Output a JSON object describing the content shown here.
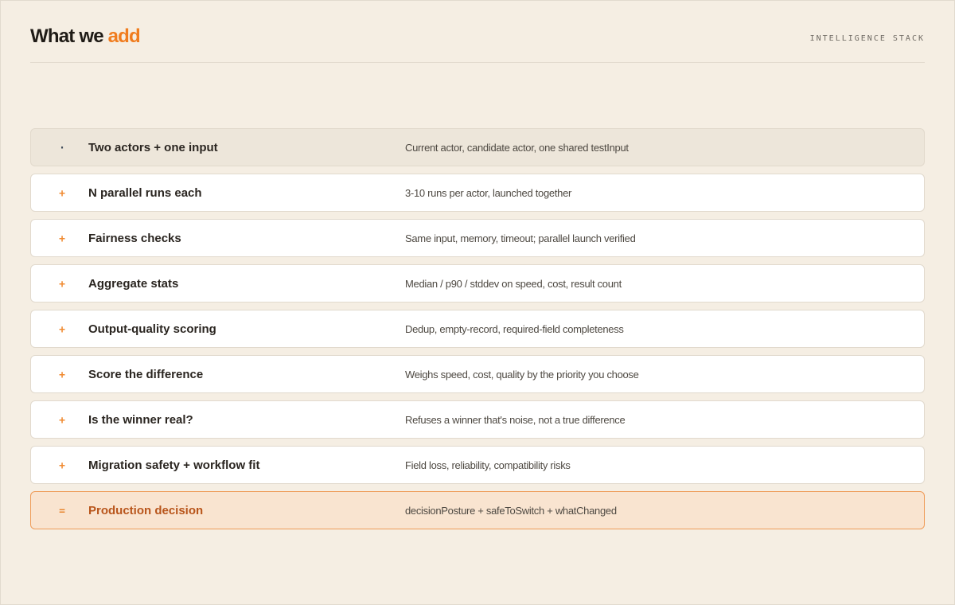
{
  "header": {
    "title_main": "What we",
    "title_accent": "add",
    "tag": "INTELLIGENCE STACK"
  },
  "colors": {
    "background": "#f5eee3",
    "accent": "#f07c1e",
    "final_row_bg": "#f9e4d0",
    "final_row_border": "#ef9b58",
    "final_label": "#b8551b"
  },
  "rows": [
    {
      "mark": "·",
      "label": "Two actors + one input",
      "desc": "Current actor, candidate actor, one shared testInput"
    },
    {
      "mark": "+",
      "label": "N parallel runs each",
      "desc": "3-10 runs per actor, launched together"
    },
    {
      "mark": "+",
      "label": "Fairness checks",
      "desc": "Same input, memory, timeout; parallel launch verified"
    },
    {
      "mark": "+",
      "label": "Aggregate stats",
      "desc": "Median / p90 / stddev on speed, cost, result count"
    },
    {
      "mark": "+",
      "label": "Output-quality scoring",
      "desc": "Dedup, empty-record, required-field completeness"
    },
    {
      "mark": "+",
      "label": "Score the difference",
      "desc": "Weighs speed, cost, quality by the priority you choose"
    },
    {
      "mark": "+",
      "label": "Is the winner real?",
      "desc": "Refuses a winner that's noise, not a true difference"
    },
    {
      "mark": "+",
      "label": "Migration safety + workflow fit",
      "desc": "Field loss, reliability, compatibility risks"
    },
    {
      "mark": "=",
      "label": "Production decision",
      "desc": "decisionPosture + safeToSwitch + whatChanged"
    }
  ]
}
